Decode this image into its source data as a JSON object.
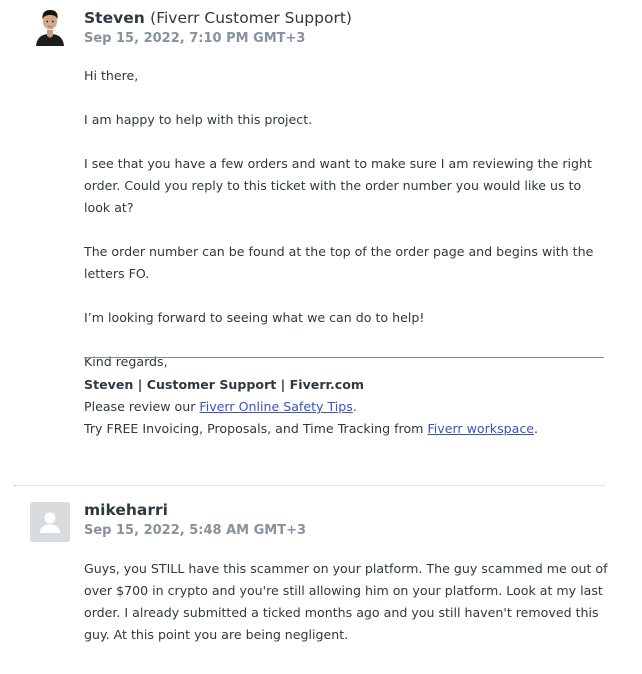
{
  "comments": [
    {
      "author": "Steven",
      "author_role": "(Fiverr Customer Support)",
      "timestamp": "Sep 15, 2022, 7:10 PM GMT+3",
      "avatar_icon": "person-photo-avatar",
      "paragraphs": [
        "Hi there,",
        "I am happy to help with this project.",
        "I see that you have a few orders and want to make sure I am reviewing the right order. Could you reply to this ticket with the order number you would like us to look at?",
        "The order number can be found at the top of the order page and begins with the letters FO.",
        "I’m looking forward to seeing what we can do to help!",
        "Kind regards,"
      ],
      "signature": {
        "name_line": "Steven | Customer Support | Fiverr.com",
        "safety_prefix": "Please review our ",
        "safety_link": "Fiverr Online Safety Tips",
        "safety_suffix": ".",
        "workspace_prefix": "Try FREE Invoicing, Proposals, and Time Tracking from ",
        "workspace_link": "Fiverr workspace",
        "workspace_suffix": "."
      }
    },
    {
      "author": "mikeharri",
      "timestamp": "Sep 15, 2022, 5:48 AM GMT+3",
      "avatar_icon": "default-user-avatar",
      "paragraphs": [
        "Guys, you STILL have this scammer on your platform. The guy scammed me out of over $700 in crypto and you're still allowing him on your platform. Look at my last order. I already submitted a ticked months ago and you still haven't removed this guy. At this point you are being negligent."
      ]
    }
  ],
  "colors": {
    "text": "#2f3941",
    "meta": "#87929d",
    "link": "#3b52c4",
    "avatar_placeholder": "#d8dcde"
  }
}
